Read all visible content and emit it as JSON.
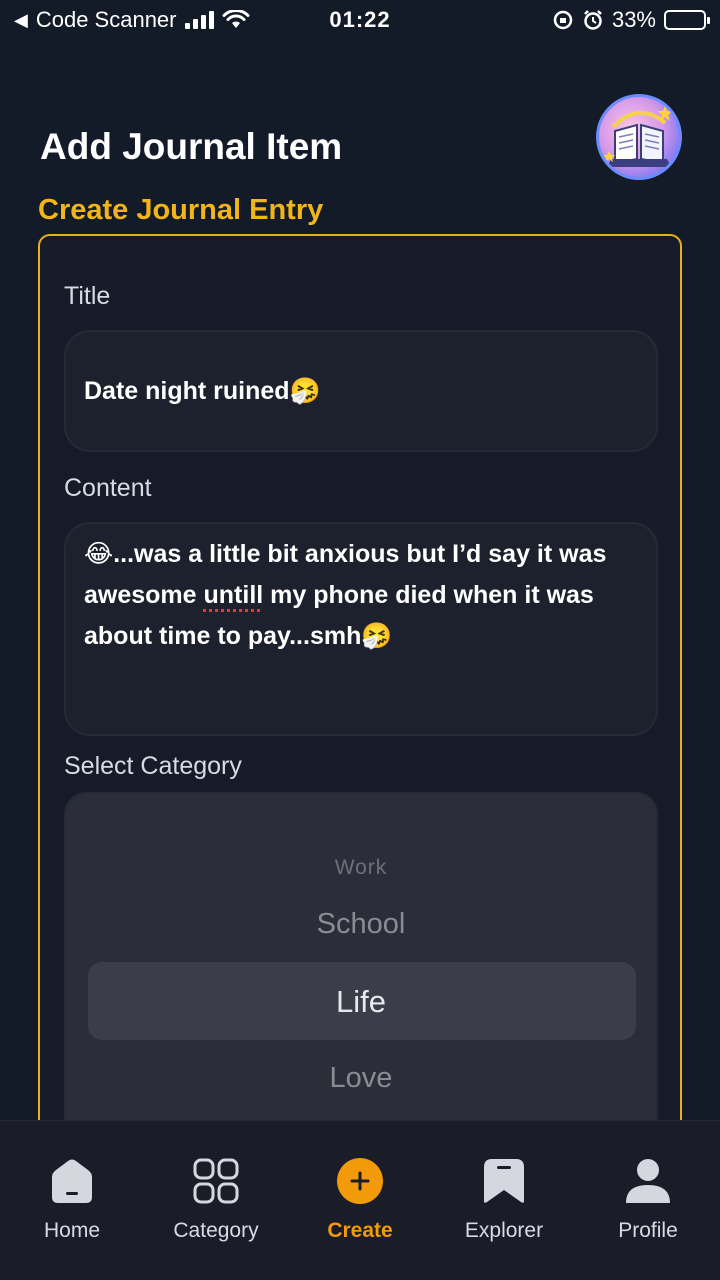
{
  "status_bar": {
    "back_app": "Code Scanner",
    "time": "01:22",
    "battery_percent": "33%",
    "battery_level": 0.33
  },
  "header": {
    "title": "Add Journal Item",
    "subtitle": "Create Journal Entry",
    "avatar_icon": "open-book-icon"
  },
  "form": {
    "title_label": "Title",
    "title_value": "Date night ruined🤧",
    "content_label": "Content",
    "content_value_line1": "😂...was a little bit anxious but I’d say it was",
    "content_value_line2_a": "awesome ",
    "content_value_line2_misspelled": "untill",
    "content_value_line2_b": " my phone died when it was",
    "content_value_line3": "about time to pay...smh🤧",
    "category_label": "Select Category",
    "category_options": [
      "Work",
      "School",
      "Life",
      "Love"
    ],
    "category_selected": "Life"
  },
  "nav": {
    "items": [
      {
        "label": "Home",
        "icon": "home-icon"
      },
      {
        "label": "Category",
        "icon": "grid-icon"
      },
      {
        "label": "Create",
        "icon": "plus-circle-icon"
      },
      {
        "label": "Explorer",
        "icon": "bookmark-icon"
      },
      {
        "label": "Profile",
        "icon": "user-icon"
      }
    ],
    "active": "Create"
  },
  "colors": {
    "accent": "#f2b518",
    "active_nav": "#f29a0a",
    "background": "#131a28"
  }
}
